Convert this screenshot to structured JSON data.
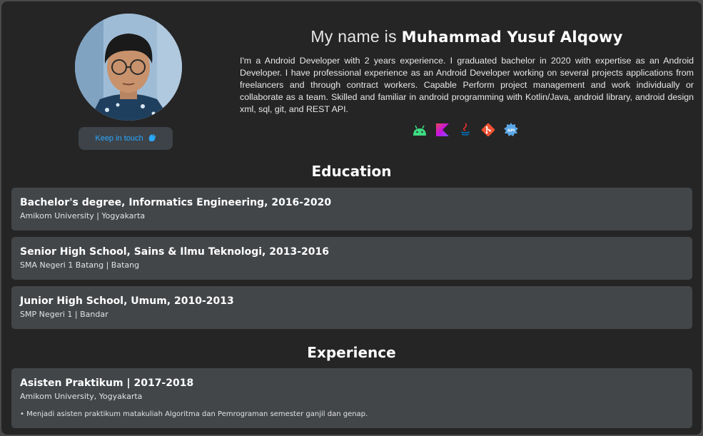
{
  "profile": {
    "button_label": "Keep in touch",
    "button_icon": "wave-hand-icon",
    "title_prefix": "My name is",
    "name": "Muhammad Yusuf Alqowy",
    "bio": "I'm a Android Developer with 2 years experience. I graduated bachelor in 2020 with expertise as an Android Developer. I have professional experience as an Android Developer working on several projects applications from freelancers and through contract workers. Capable Perform project management and work individually or collaborate as a team. Skilled and familiar in android programming with Kotlin/Java, android library, android design xml, sql, git, and REST API.",
    "skills": [
      "android-icon",
      "kotlin-icon",
      "java-icon",
      "git-icon",
      "api-icon"
    ]
  },
  "education": {
    "heading": "Education",
    "items": [
      {
        "title": "Bachelor's degree, Informatics Engineering, 2016-2020",
        "place": "Amikom University | Yogyakarta"
      },
      {
        "title": "Senior High School, Sains & Ilmu Teknologi, 2013-2016",
        "place": "SMA Negeri 1 Batang | Batang"
      },
      {
        "title": "Junior High School, Umum, 2010-2013",
        "place": "SMP Negeri 1 | Bandar"
      }
    ]
  },
  "experience": {
    "heading": "Experience",
    "items": [
      {
        "title": "Asisten Praktikum | 2017-2018",
        "place": "Amikom University, Yogyakarta",
        "bullet": "• Menjadi asisten praktikum matakuliah Algoritma dan Pemrograman semester ganjil dan genap."
      }
    ]
  },
  "colors": {
    "page_bg": "#252525",
    "card_bg": "#434649",
    "accent": "#2aa8ff"
  }
}
